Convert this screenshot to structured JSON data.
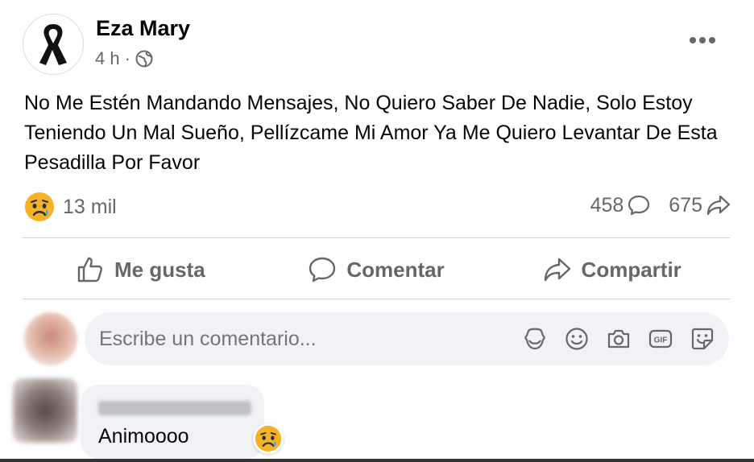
{
  "post": {
    "author": "Eza Mary",
    "time": "4 h",
    "separator": "·",
    "privacy_icon": "globe-icon",
    "avatar_icon": "black-ribbon-icon",
    "body": "No Me Estén Mandando Mensajes, No Quiero Saber De Nadie, Solo Estoy Teniendo Un Mal Sueño, Pellízcame Mi Amor Ya Me Quiero Levantar De Esta Pesadilla Por Favor",
    "reaction_icon": "sad-face-icon",
    "reaction_count": "13 mil",
    "comment_count": "458",
    "share_count": "675"
  },
  "actions": {
    "like": "Me gusta",
    "comment": "Comentar",
    "share": "Compartir"
  },
  "composer": {
    "placeholder": "Escribe un comentario...",
    "icons": [
      "avatar-sticker-icon",
      "emoji-icon",
      "camera-icon",
      "gif-icon",
      "sticker-icon"
    ]
  },
  "comment": {
    "text": "Animoooo",
    "reaction_icon": "sad-face-icon"
  },
  "colors": {
    "secondary_text": "#65676b",
    "bubble_bg": "#f0f2f5",
    "divider": "#ced0d4",
    "reaction_yellow": "#f7b125"
  }
}
